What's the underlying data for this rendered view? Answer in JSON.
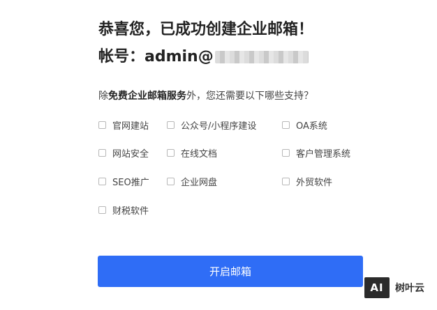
{
  "header": {
    "title": "恭喜您，已成功创建企业邮箱！",
    "account_label": "帐号：admin@"
  },
  "question": {
    "prefix": "除",
    "bold": "免费企业邮箱服务",
    "suffix": "外，您还需要以下哪些支持？"
  },
  "options": [
    {
      "label": "官网建站",
      "checked": false
    },
    {
      "label": "公众号/小程序建设",
      "checked": false
    },
    {
      "label": "OA系统",
      "checked": false
    },
    {
      "label": "网站安全",
      "checked": false
    },
    {
      "label": "在线文档",
      "checked": false
    },
    {
      "label": "客户管理系统",
      "checked": false
    },
    {
      "label": "SEO推广",
      "checked": false
    },
    {
      "label": "企业网盘",
      "checked": false
    },
    {
      "label": "外贸软件",
      "checked": false
    },
    {
      "label": "财税软件",
      "checked": false
    }
  ],
  "submit_label": "开启邮箱",
  "watermark": {
    "logo": "AI",
    "text": "树叶云"
  },
  "colors": {
    "primary": "#2f6df6",
    "background": "#ffffff"
  }
}
